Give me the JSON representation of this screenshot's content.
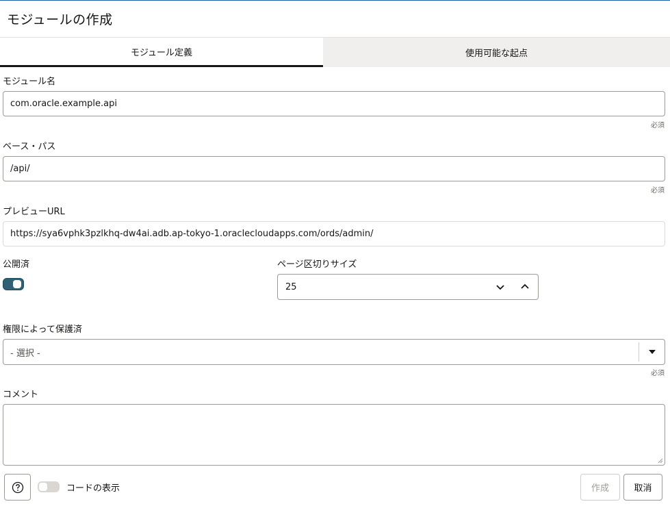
{
  "dialog": {
    "title": "モジュールの作成"
  },
  "tabs": [
    {
      "label": "モジュール定義",
      "active": true
    },
    {
      "label": "使用可能な起点",
      "active": false
    }
  ],
  "form": {
    "module_name": {
      "label": "モジュール名",
      "value": "com.oracle.example.api",
      "hint": "必須"
    },
    "base_path": {
      "label": "ベース・パス",
      "value": "/api/",
      "hint": "必須"
    },
    "preview_url": {
      "label": "プレビューURL",
      "value": "https://sya6vphk3pzlkhq-dw4ai.adb.ap-tokyo-1.oraclecloudapps.com/ords/admin/"
    },
    "published": {
      "label": "公開済",
      "on": true
    },
    "page_size": {
      "label": "ページ区切りサイズ",
      "value": "25"
    },
    "protected_by": {
      "label": "権限によって保護済",
      "placeholder": "- 選択 -",
      "hint": "必須"
    },
    "comment": {
      "label": "コメント",
      "value": ""
    }
  },
  "footer": {
    "help_icon": "help-circle-icon",
    "show_code_label": "コードの表示",
    "show_code_on": false,
    "create_label": "作成",
    "cancel_label": "取消"
  },
  "colors": {
    "accent": "#2f6076",
    "topline": "#1f5ea8"
  }
}
